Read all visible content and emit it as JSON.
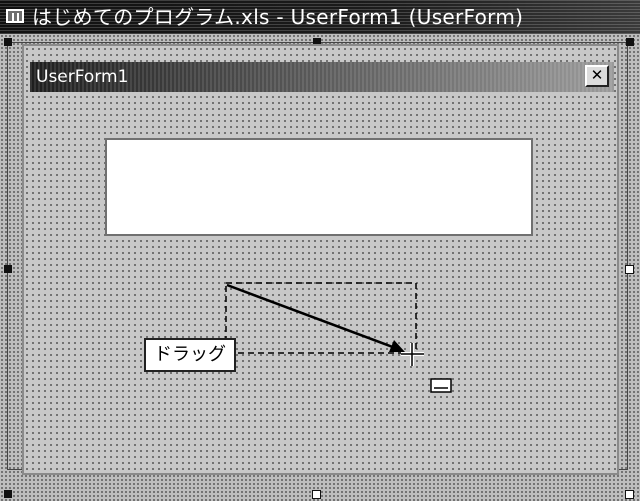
{
  "window": {
    "title": "はじめてのプログラム.xls - UserForm1 (UserForm)",
    "icon": "vba-form-icon"
  },
  "user_form": {
    "caption": "UserForm1",
    "close_glyph": "✕"
  },
  "annotation": {
    "drag_label": "ドラッグ"
  },
  "colors": {
    "title_bar": "#141414",
    "designer_bg": "#bdbdbd",
    "form_bg": "#c8c8c8",
    "control_bg": "#ffffff"
  }
}
